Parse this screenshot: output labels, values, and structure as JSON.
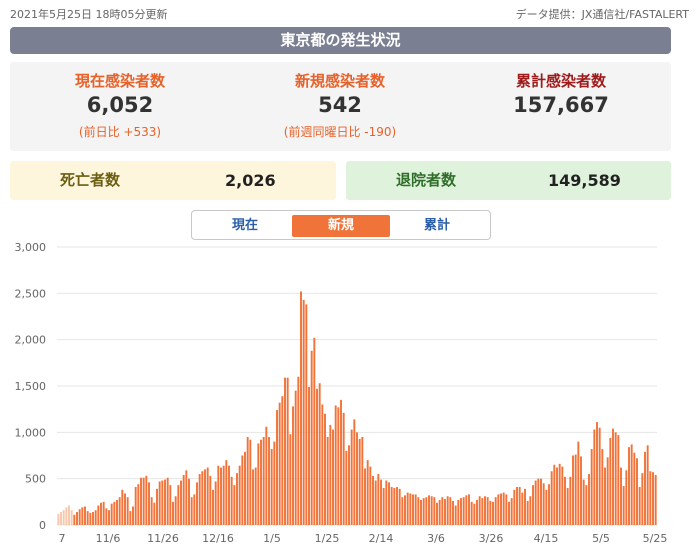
{
  "header": {
    "updated": "2021年5月25日 18時05分更新",
    "source": "データ提供：JX通信社/FASTALERT",
    "title": "東京都の発生状況"
  },
  "stats": {
    "current": {
      "label": "現在感染者数",
      "value": "6,052",
      "diff": "(前日比 +533)"
    },
    "new": {
      "label": "新規感染者数",
      "value": "542",
      "diff": "(前週同曜日比 -190)"
    },
    "cumulative": {
      "label": "累計感染者数",
      "value": "157,667"
    }
  },
  "deaths": {
    "label": "死亡者数",
    "value": "2,026"
  },
  "recovered": {
    "label": "退院者数",
    "value": "149,589"
  },
  "tabs": [
    {
      "label": "現在"
    },
    {
      "label": "新規",
      "active": true
    },
    {
      "label": "累計"
    }
  ],
  "colors": {
    "bar": "#f0743a",
    "bar_faded": "#f8c7ac",
    "grid": "#e6e6e6",
    "axis_text": "#666666"
  },
  "chart_data": {
    "type": "bar",
    "ylim": [
      0,
      3000
    ],
    "yticks": [
      "0",
      "500",
      "1,000",
      "1,500",
      "2,000",
      "2,500",
      "3,000"
    ],
    "xtick_labels": [
      "7",
      "11/6",
      "11/26",
      "12/16",
      "1/5",
      "1/25",
      "2/14",
      "3/6",
      "3/26",
      "4/15",
      "5/5",
      "5/25"
    ],
    "series": [
      {
        "values": [
          120,
          140,
          160,
          190,
          210,
          160,
          110,
          140,
          170,
          190,
          200,
          150,
          130,
          140,
          160,
          210,
          240,
          250,
          180,
          160,
          230,
          250,
          270,
          300,
          380,
          340,
          300,
          150,
          200,
          410,
          440,
          510,
          510,
          530,
          460,
          300,
          240,
          390,
          470,
          480,
          490,
          510,
          430,
          250,
          310,
          430,
          480,
          540,
          590,
          500,
          300,
          330,
          460,
          550,
          580,
          600,
          620,
          530,
          380,
          470,
          640,
          620,
          640,
          700,
          640,
          520,
          430,
          560,
          640,
          750,
          790,
          950,
          920,
          600,
          620,
          880,
          920,
          950,
          1060,
          950,
          820,
          900,
          1240,
          1320,
          1390,
          1590,
          1590,
          980,
          1280,
          1450,
          1600,
          2520,
          2430,
          2380,
          1490,
          1880,
          2020,
          1470,
          1530,
          1300,
          1200,
          950,
          1080,
          1030,
          1290,
          1270,
          1350,
          1210,
          800,
          860,
          1030,
          1140,
          1000,
          930,
          950,
          610,
          700,
          630,
          530,
          480,
          550,
          490,
          400,
          480,
          460,
          410,
          400,
          410,
          390,
          300,
          320,
          350,
          340,
          330,
          330,
          300,
          270,
          290,
          300,
          320,
          310,
          300,
          240,
          270,
          300,
          280,
          310,
          300,
          260,
          210,
          270,
          290,
          300,
          320,
          330,
          250,
          230,
          270,
          310,
          290,
          310,
          300,
          260,
          250,
          300,
          330,
          340,
          350,
          330,
          250,
          290,
          380,
          410,
          410,
          350,
          390,
          260,
          310,
          430,
          480,
          500,
          500,
          450,
          380,
          440,
          580,
          650,
          620,
          660,
          630,
          520,
          400,
          520,
          750,
          760,
          900,
          740,
          490,
          430,
          550,
          820,
          1030,
          1110,
          1050,
          820,
          620,
          730,
          940,
          1040,
          1000,
          970,
          620,
          420,
          590,
          840,
          870,
          780,
          720,
          410,
          560,
          790,
          860,
          580,
          570,
          540
        ]
      }
    ]
  }
}
